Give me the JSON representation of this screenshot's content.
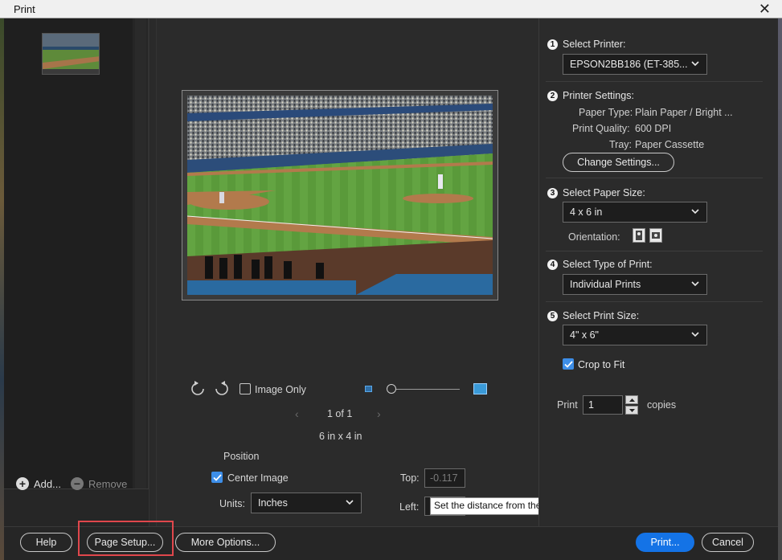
{
  "window": {
    "title": "Print",
    "close_glyph": "✕"
  },
  "thumbs": {
    "add_label": "Add...",
    "remove_label": "Remove"
  },
  "preview": {
    "image_only_label": "Image Only",
    "page_indicator": "1 of 1",
    "page_size_label": "6 in x 4 in",
    "position_header": "Position",
    "center_image_label": "Center Image",
    "center_image_checked": true,
    "units_label": "Units:",
    "units_value": "Inches",
    "top_label": "Top:",
    "top_value": "-0.117",
    "left_label": "Left:",
    "tooltip": "Set the distance from the top"
  },
  "settings": {
    "printer": {
      "step": "1",
      "label": "Select Printer:",
      "value": "EPSON2BB186 (ET-385..."
    },
    "printer_settings": {
      "step": "2",
      "label": "Printer Settings:",
      "paper_type_key": "Paper Type:",
      "paper_type_val": "Plain Paper / Bright ...",
      "quality_key": "Print Quality:",
      "quality_val": "600 DPI",
      "tray_key": "Tray:",
      "tray_val": "Paper Cassette",
      "change_button": "Change Settings..."
    },
    "paper_size": {
      "step": "3",
      "label": "Select Paper Size:",
      "value": "4 x 6 in",
      "orientation_label": "Orientation:"
    },
    "print_type": {
      "step": "4",
      "label": "Select Type of Print:",
      "value": "Individual Prints"
    },
    "print_size": {
      "step": "5",
      "label": "Select Print Size:",
      "value": "4\" x 6\"",
      "crop_label": "Crop to Fit",
      "crop_checked": true
    },
    "copies": {
      "prefix": "Print",
      "value": "1",
      "suffix": "copies"
    }
  },
  "footer": {
    "help": "Help",
    "page_setup": "Page Setup...",
    "more_options": "More Options...",
    "print": "Print...",
    "cancel": "Cancel"
  },
  "colors": {
    "accent": "#1473e6",
    "highlight": "#e0474c",
    "checkbox": "#3d8ee8"
  }
}
